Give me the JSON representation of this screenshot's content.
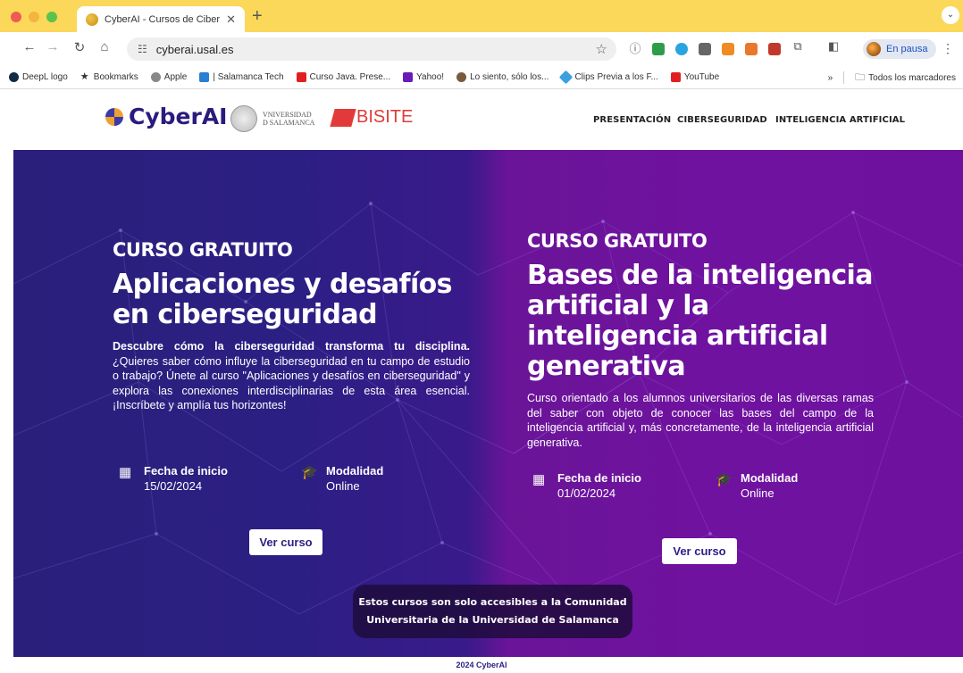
{
  "browser": {
    "tab_title": "CyberAI - Cursos de Ciberse",
    "new_tab": "+",
    "url": "cyberai.usal.es",
    "profile_status": "En pausa",
    "bookmarks": [
      {
        "label": "DeepL logo",
        "color": "#0f2b46"
      },
      {
        "label": "Bookmarks",
        "color": "#222222"
      },
      {
        "label": "Apple",
        "color": "#888888"
      },
      {
        "label": "| Salamanca Tech",
        "color": "#2a7fd4"
      },
      {
        "label": "Curso Java. Prese...",
        "color": "#e02020"
      },
      {
        "label": "Yahoo!",
        "color": "#6a1ab8"
      },
      {
        "label": "Lo siento, sólo los...",
        "color": "#7a5a3a"
      },
      {
        "label": "Clips Previa a los F...",
        "color": "#3aa0e0"
      },
      {
        "label": "YouTube",
        "color": "#e02020"
      }
    ],
    "overflow": "»",
    "all_bookmarks": "Todos los marcadores"
  },
  "site": {
    "brand": "CyberAI",
    "university_line1": "VNIVERSIDAD",
    "university_line2": "D SALAMANCA",
    "partner": "BISITE",
    "nav": [
      "PRESENTACIÓN",
      "CIBERSEGURIDAD",
      "INTELIGENCIA ARTIFICIAL"
    ]
  },
  "courses": [
    {
      "kicker": "CURSO GRATUITO",
      "title": "Aplicaciones y desafíos en ciberseguridad",
      "desc_lead": "Descubre cómo la ciberseguridad transforma tu disciplina.",
      "desc": " ¿Quieres saber cómo influye la ciberseguridad en tu campo de estudio o trabajo? Únete al curso \"Aplicaciones y desafíos en ciberseguridad\" y explora las conexiones interdisciplinarias de esta área esencial. ¡Inscríbete y amplía tus horizontes!",
      "start_label": "Fecha de inicio",
      "start_date": "15/02/2024",
      "mode_label": "Modalidad",
      "mode": "Online",
      "button": "Ver curso"
    },
    {
      "kicker": "CURSO GRATUITO",
      "title": "Bases de la inteligencia artificial y la inteligencia artificial generativa",
      "desc": "Curso orientado a los alumnos universitarios de las diversas ramas del saber con objeto de conocer las bases del campo de la inteligencia artificial y, más concretamente, de la inteligencia artificial generativa.",
      "start_label": "Fecha de inicio",
      "start_date": "01/02/2024",
      "mode_label": "Modalidad",
      "mode": "Online",
      "button": "Ver curso"
    }
  ],
  "notice": {
    "line1": "Estos cursos son solo accesibles a la Comunidad",
    "line2": "Universitaria de la Universidad de Salamanca"
  },
  "footer": "2024 CyberAI",
  "colors": {
    "tabbar": "#fbd85a",
    "hero_left": "#2c1f84",
    "hero_right": "#7012a0",
    "brand": "#2c1a7e",
    "bisite": "#e23a3a"
  }
}
